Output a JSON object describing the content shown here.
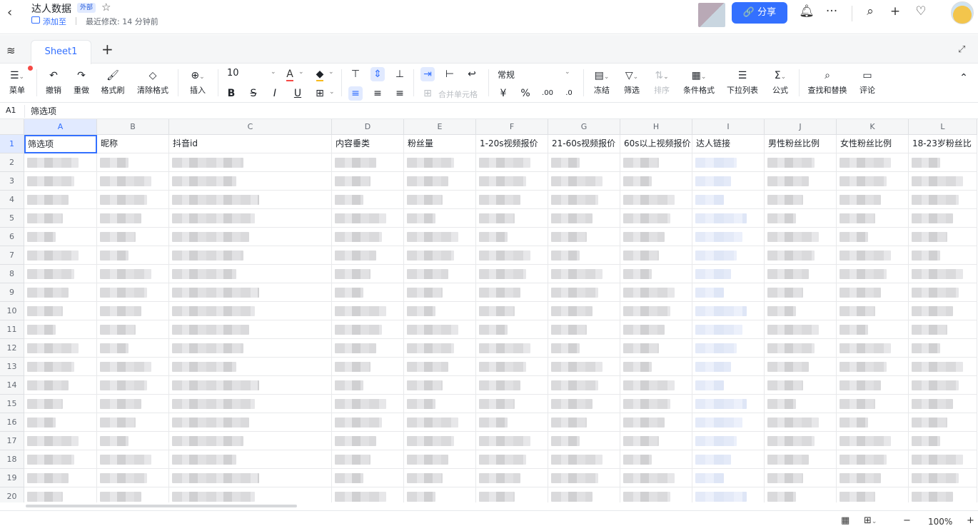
{
  "header": {
    "title": "达人数据",
    "badge": "外部",
    "add_to": "添加至",
    "modified": "最近修改: 14 分钟前",
    "share_label": "分享"
  },
  "sheet_tabs": {
    "active": "Sheet1"
  },
  "toolbar": {
    "menu": "菜单",
    "undo": "撤销",
    "redo": "重做",
    "format_painter": "格式刷",
    "clear_format": "清除格式",
    "insert": "插入",
    "font_size": "10",
    "merge_cells": "合并单元格",
    "number_format": "常规",
    "currency": "¥",
    "percent": "%",
    "freeze": "冻结",
    "filter": "筛选",
    "sort": "排序",
    "conditional_format": "条件格式",
    "dropdown_list": "下拉列表",
    "formula": "公式",
    "find_replace": "查找和替换",
    "comment": "评论"
  },
  "formula_bar": {
    "cell_ref": "A1",
    "content": "筛选项"
  },
  "grid": {
    "columns": [
      "A",
      "B",
      "C",
      "D",
      "E",
      "F",
      "G",
      "H",
      "I",
      "J",
      "K",
      "L"
    ],
    "rows": [
      "1",
      "2",
      "3",
      "4",
      "5",
      "6",
      "7",
      "8",
      "9",
      "10",
      "11",
      "12",
      "13",
      "14",
      "15",
      "16",
      "17",
      "18",
      "19",
      "20"
    ],
    "header_row": [
      "筛选项",
      "昵称",
      "抖音id",
      "内容垂类",
      "粉丝量",
      "1-20s视频报价",
      "21-60s视频报价",
      "60s以上视频报价",
      "达人链接",
      "男性粉丝比例",
      "女性粉丝比例",
      "18-23岁粉丝比"
    ]
  },
  "status": {
    "zoom": "100%"
  }
}
